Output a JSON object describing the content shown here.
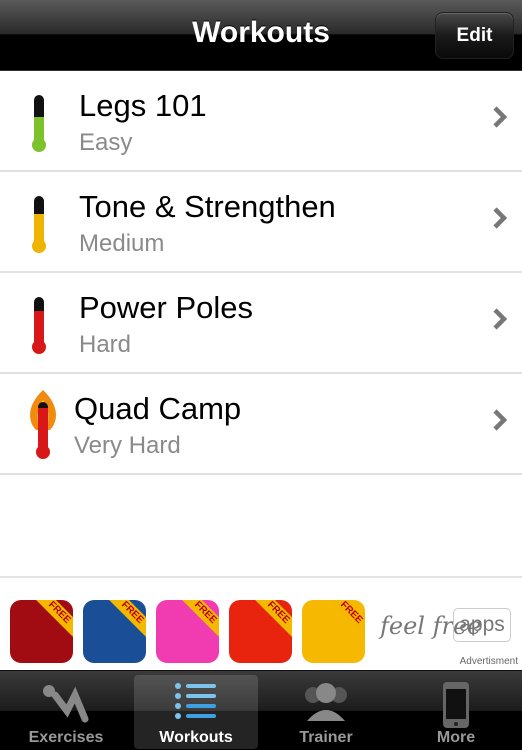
{
  "nav": {
    "title": "Workouts",
    "edit_label": "Edit"
  },
  "workouts": [
    {
      "name": "Legs 101",
      "difficulty": "Easy",
      "color": "#7dc22a",
      "level": 0.6,
      "flame": false
    },
    {
      "name": "Tone & Strengthen",
      "difficulty": "Medium",
      "color": "#f0b400",
      "level": 0.7,
      "flame": false
    },
    {
      "name": "Power Poles",
      "difficulty": "Hard",
      "color": "#d81818",
      "level": 0.8,
      "flame": false
    },
    {
      "name": "Quad Camp",
      "difficulty": "Very Hard",
      "color": "#d81818",
      "level": 1.0,
      "flame": true
    }
  ],
  "ad": {
    "apps": [
      {
        "color": "#a00c12",
        "badge": "FREE"
      },
      {
        "color": "#1a4e96",
        "badge": "FREE"
      },
      {
        "color": "#f03cb0",
        "badge": "FREE"
      },
      {
        "color": "#e8230e",
        "badge": "FREE"
      },
      {
        "color": "#f6b800",
        "badge": "FREE"
      }
    ],
    "brand": "feel free",
    "brand_apps": "apps",
    "label": "Advertisment"
  },
  "tabs": [
    {
      "label": "Exercises",
      "icon": "situp-icon"
    },
    {
      "label": "Workouts",
      "icon": "list-icon",
      "selected": true
    },
    {
      "label": "Trainer",
      "icon": "people-icon"
    },
    {
      "label": "More",
      "icon": "phone-icon"
    }
  ]
}
